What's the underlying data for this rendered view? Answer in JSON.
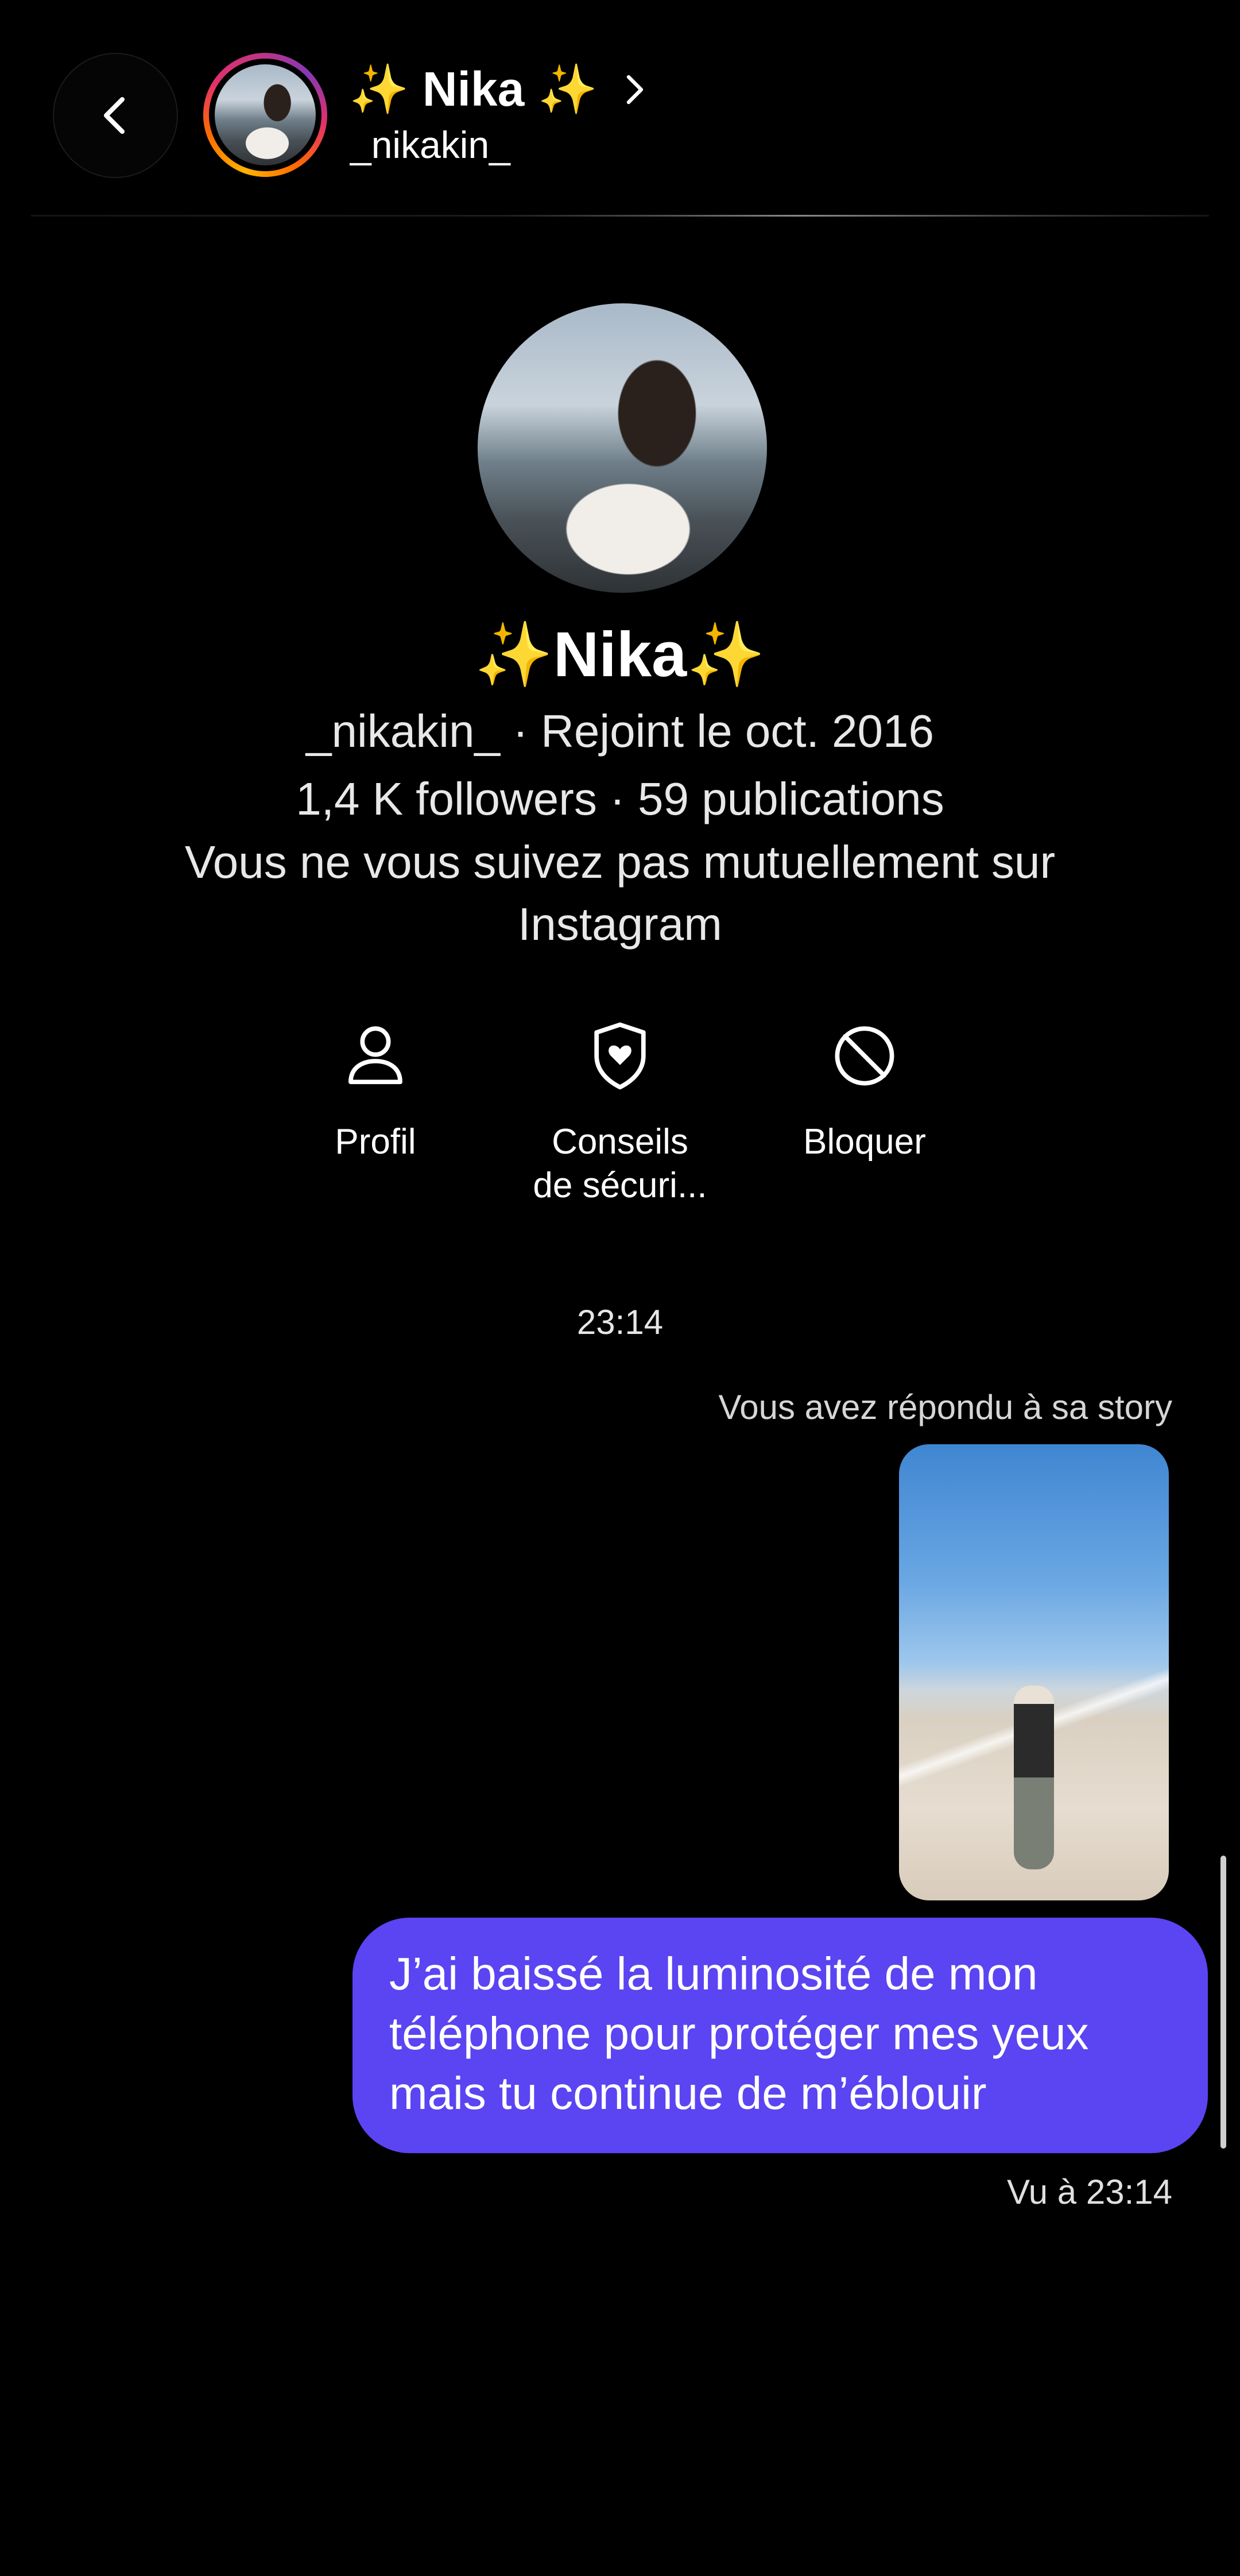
{
  "header": {
    "name": "✨ Nika ✨",
    "username": "_nikakin_"
  },
  "profile": {
    "name": "✨Nika✨",
    "handle_joined": "_nikakin_ · Rejoint le oct. 2016",
    "stats": "1,4 K followers · 59 publications",
    "mutual_line1": "Vous ne vous suivez pas mutuellement sur",
    "mutual_line2": "Instagram"
  },
  "actions": [
    {
      "label": "Profil",
      "icon": "user-icon"
    },
    {
      "label_line1": "Conseils",
      "label_line2": "de sécuri...",
      "icon": "shield-heart-icon"
    },
    {
      "label": "Bloquer",
      "icon": "block-icon"
    }
  ],
  "conversation": {
    "timestamp": "23:14",
    "story_reply_note": "Vous avez répondu à sa story",
    "message_lines": [
      "J’ai baissé la luminosité de mon",
      "téléphone pour protéger mes yeux",
      "mais tu continue de m’éblouir"
    ],
    "seen": "Vu à 23:14"
  },
  "colors": {
    "background": "#000000",
    "bubble": "#5b44f2",
    "story_ring": [
      "#ffb300",
      "#ff6a00",
      "#e1306c",
      "#833ab4"
    ]
  }
}
